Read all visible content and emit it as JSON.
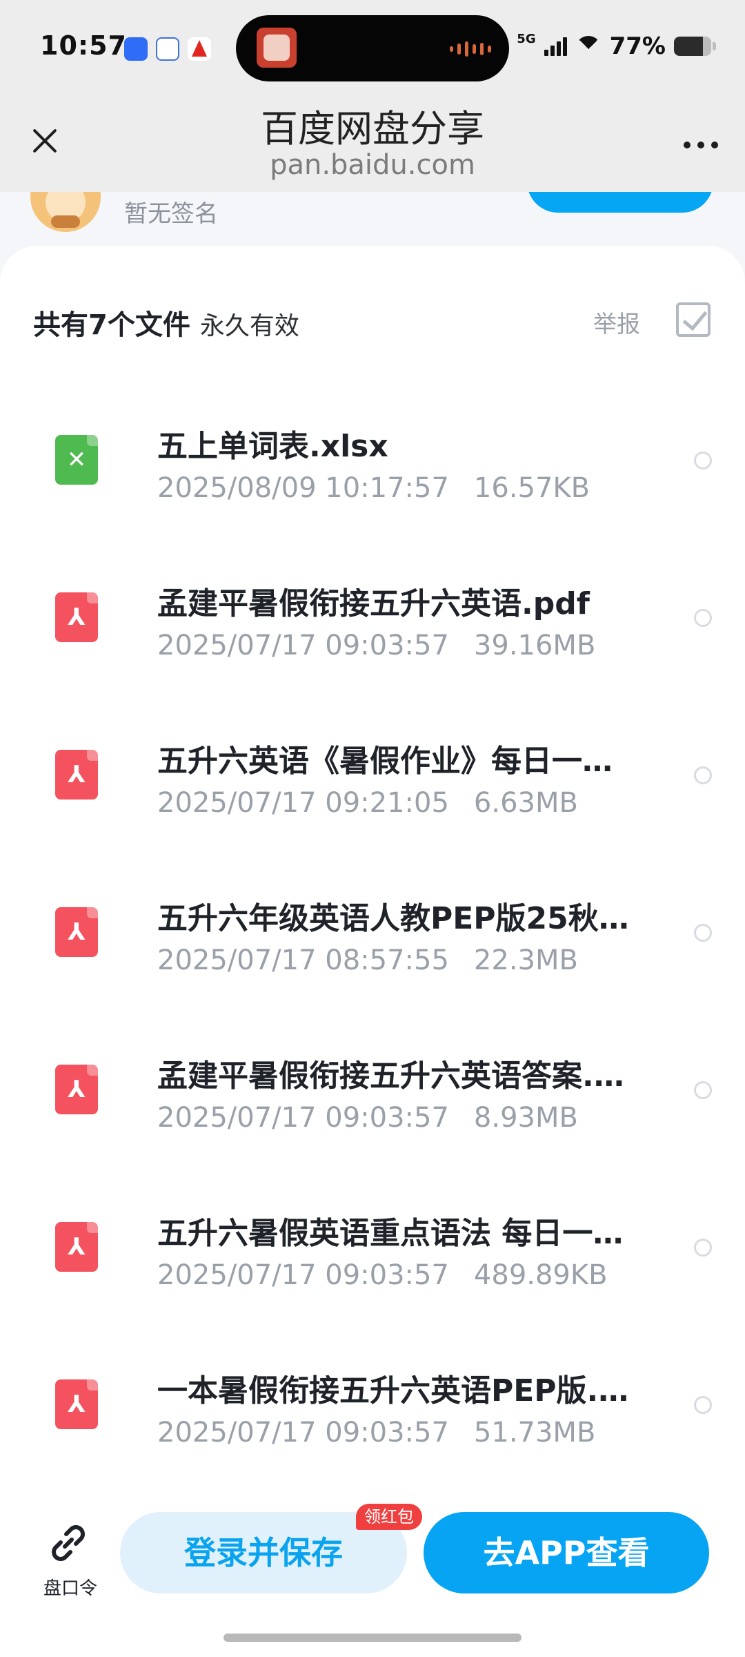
{
  "status_bar": {
    "time": "10:57",
    "network": "5G",
    "battery_percent": "77%",
    "battery_level": 0.77
  },
  "header": {
    "title": "百度网盘分享",
    "url": "pan.baidu.com"
  },
  "sharer": {
    "signature": "暂无签名"
  },
  "file_summary": {
    "count_text": "共有7个文件",
    "validity": "永久有效",
    "report": "举报"
  },
  "files": [
    {
      "name": "五上单词表.xlsx",
      "date": "2025/08/09 10:17:57",
      "size": "16.57KB",
      "type": "xlsx"
    },
    {
      "name": "孟建平暑假衔接五升六英语.pdf",
      "date": "2025/07/17 09:03:57",
      "size": "39.16MB",
      "type": "pdf"
    },
    {
      "name": "五升六英语《暑假作业》每日一…",
      "date": "2025/07/17 09:21:05",
      "size": "6.63MB",
      "type": "pdf"
    },
    {
      "name": "五升六年级英语人教PEP版25秋…",
      "date": "2025/07/17 08:57:55",
      "size": "22.3MB",
      "type": "pdf"
    },
    {
      "name": "孟建平暑假衔接五升六英语答案.…",
      "date": "2025/07/17 09:03:57",
      "size": "8.93MB",
      "type": "pdf"
    },
    {
      "name": "五升六暑假英语重点语法 每日一…",
      "date": "2025/07/17 09:03:57",
      "size": "489.89KB",
      "type": "pdf"
    },
    {
      "name": "一本暑假衔接五升六英语PEP版.pdf",
      "date": "2025/07/17 09:03:57",
      "size": "51.73MB",
      "type": "pdf"
    }
  ],
  "bottom_bar": {
    "link_label": "盘口令",
    "save_label": "登录并保存",
    "badge": "领红包",
    "app_label": "去APP查看"
  },
  "icons": {
    "close": "close-icon",
    "more": "more-icon",
    "select_all": "checkbox-icon",
    "link": "link-icon",
    "xlsx": "excel-file-icon",
    "pdf": "pdf-file-icon"
  },
  "colors": {
    "accent": "#06a4f3",
    "accent_light": "#e1f1fc",
    "badge_red": "#ef3f3f",
    "pdf_red": "#f4525e",
    "xlsx_green": "#4fba4f"
  }
}
